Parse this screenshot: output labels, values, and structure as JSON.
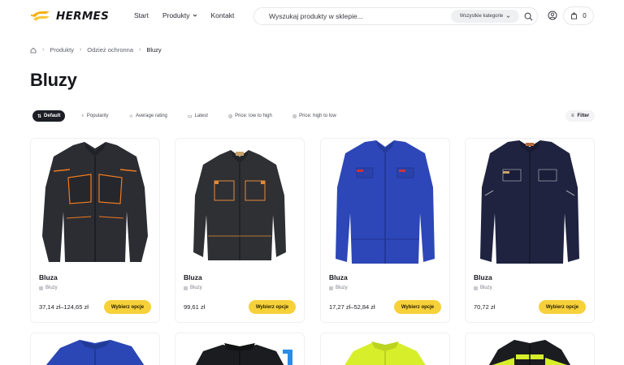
{
  "header": {
    "brand": "HERMES",
    "nav": [
      {
        "label": "Start"
      },
      {
        "label": "Produkty"
      },
      {
        "label": "Kontakt"
      }
    ],
    "search": {
      "placeholder": "Wyszukaj produkty w sklepie...",
      "category_select": "Wszystkie kategorie"
    },
    "cart_count": "0",
    "icons": [
      "logo-mark-icon",
      "chevron-down-icon",
      "search-icon",
      "user-icon",
      "cart-icon"
    ]
  },
  "breadcrumb": {
    "items": [
      "Produkty",
      "Odzież ochronna"
    ],
    "current": "Bluzy"
  },
  "page_title": "Bluzy",
  "sort": {
    "options": [
      {
        "label": "Default",
        "active": true
      },
      {
        "label": "Popularity",
        "active": false
      },
      {
        "label": "Average rating",
        "active": false
      },
      {
        "label": "Latest",
        "active": false
      },
      {
        "label": "Price: low to high",
        "active": false
      },
      {
        "label": "Price: high to low",
        "active": false
      }
    ],
    "filter_label": "Filter"
  },
  "products": [
    {
      "name": "Bluza",
      "category": "Bluzy",
      "price": "37,14 zł–124,65 zł",
      "button": "Wybierz opcje",
      "colors": {
        "body": "#2b2d33",
        "accent": "#f07a1f"
      }
    },
    {
      "name": "Bluza",
      "category": "Bluzy",
      "price": "99,61 zł",
      "button": "Wybierz opcje",
      "colors": {
        "body": "#2f3034",
        "accent": "#e08a3a"
      }
    },
    {
      "name": "Bluza",
      "category": "Bluzy",
      "price": "17,27 zł–52,84 zł",
      "button": "Wybierz opcje",
      "colors": {
        "body": "#2d47b8",
        "accent": "#d0303a"
      }
    },
    {
      "name": "Bluza",
      "category": "Bluzy",
      "price": "70,72 zł",
      "button": "Wybierz opcje",
      "colors": {
        "body": "#1f2340",
        "accent": "#9a9ca6"
      }
    }
  ],
  "colors": {
    "accent_yellow": "#f6d13a",
    "dark": "#1d1f26"
  }
}
